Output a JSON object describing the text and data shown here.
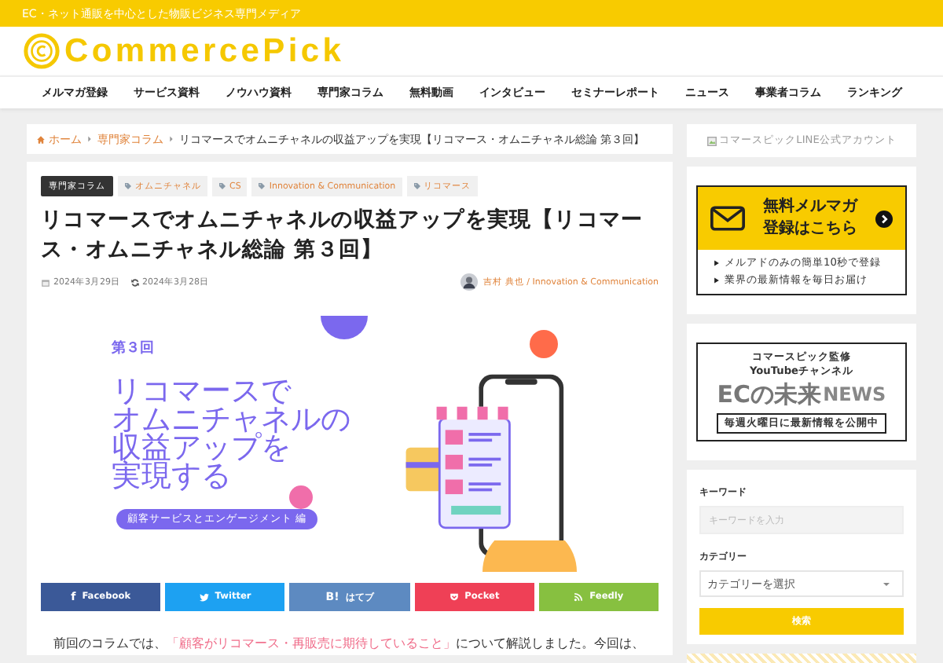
{
  "top_bar": {
    "tagline": "EC・ネット通販を中心とした物販ビジネス専門メディア"
  },
  "logo": {
    "text": "CommercePick"
  },
  "nav": [
    {
      "label": "メルマガ登録"
    },
    {
      "label": "サービス資料"
    },
    {
      "label": "ノウハウ資料"
    },
    {
      "label": "専門家コラム"
    },
    {
      "label": "無料動画"
    },
    {
      "label": "インタビュー"
    },
    {
      "label": "セミナーレポート"
    },
    {
      "label": "ニュース"
    },
    {
      "label": "事業者コラム"
    },
    {
      "label": "ランキング"
    }
  ],
  "breadcrumb": [
    {
      "label": "ホーム",
      "kind": "home"
    },
    {
      "label": "専門家コラム",
      "kind": "link"
    },
    {
      "label": "リコマースでオムニチャネルの収益アップを実現【リコマース・オムニチャネル総論 第３回】",
      "kind": "current"
    }
  ],
  "article": {
    "category": "専門家コラム",
    "tags": [
      "オムニチャネル",
      "CS",
      "Innovation & Communication",
      "リコマース"
    ],
    "title": "リコマースでオムニチャネルの収益アップを実現【リコマース・オムニチャネル総論 第３回】",
    "published": "2024年3月29日",
    "updated": "2024年3月28日",
    "author": "吉村 典也 / Innovation & Communication",
    "hero": {
      "episode": "第３回",
      "headline": [
        "リコマースで",
        "オムニチャネルの",
        "収益アップを",
        "実現する"
      ],
      "pill": "顧客サービスとエンゲージメント 編"
    },
    "share": [
      {
        "kind": "facebook",
        "label": "Facebook",
        "icon_text": "f"
      },
      {
        "kind": "twitter",
        "label": "Twitter"
      },
      {
        "kind": "hatena",
        "label": "はてブ",
        "icon_text": "B!"
      },
      {
        "kind": "pocket",
        "label": "Pocket"
      },
      {
        "kind": "feedly",
        "label": "Feedly"
      }
    ],
    "intro": "前回のコラムでは、**「顧客がリコマース・再販売に期待していること」**について解説しました。今回は、"
  },
  "sidebar": {
    "line_alt": "コマースピックLINE公式アカウント",
    "mail_banner": {
      "title": [
        "無料メルマガ",
        "登録はこちら"
      ],
      "points": [
        "メルアドのみの簡単10秒で登録",
        "業界の最新情報を毎日お届け"
      ]
    },
    "youtube_banner": {
      "caption": [
        "コマースピック監修",
        "YouTubeチャンネル"
      ],
      "logo": "ECの未来",
      "logo_suffix": "NEWS",
      "note": "毎週火曜日に最新情報を公開中"
    },
    "search": {
      "keyword_label": "キーワード",
      "keyword_placeholder": "キーワードを入力",
      "category_label": "カテゴリー",
      "category_value": "カテゴリーを選択",
      "button": "検索"
    }
  }
}
